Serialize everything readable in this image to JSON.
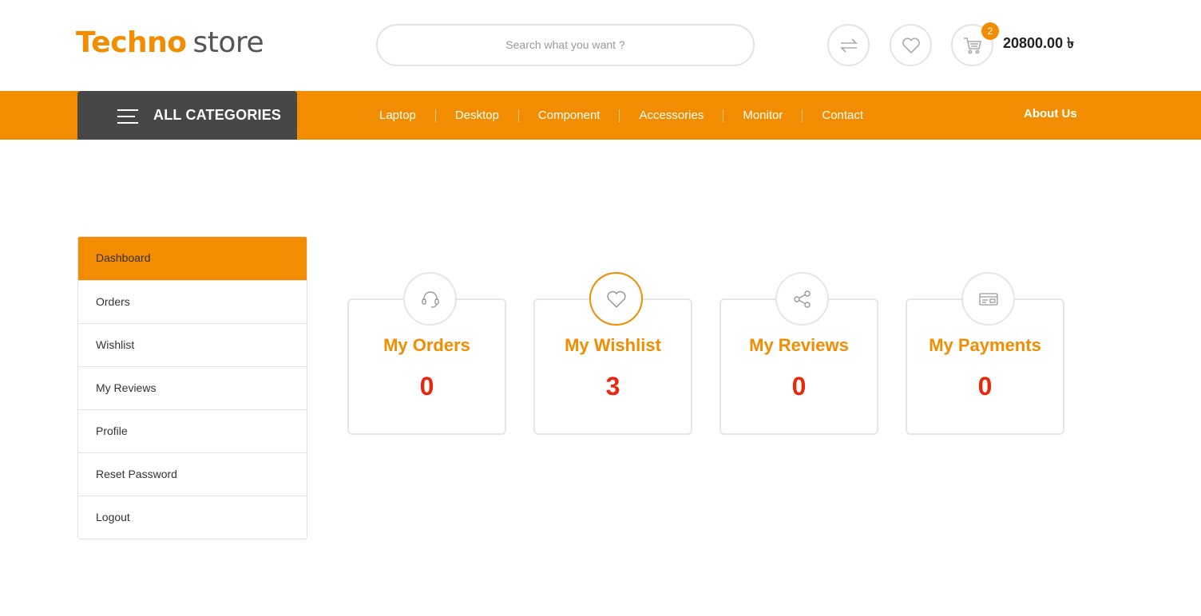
{
  "header": {
    "logo_part1": "Techno",
    "logo_part2": "store",
    "search_placeholder": "Search what you want ?",
    "cart_count": "2",
    "cart_total": "20800.00 ৳",
    "icons": [
      "compare-icon",
      "heart-icon",
      "cart-icon"
    ]
  },
  "nav": {
    "all_categories": "ALL CATEGORIES",
    "links": [
      "Laptop",
      "Desktop",
      "Component",
      "Accessories",
      "Monitor",
      "Contact"
    ],
    "about": "About Us"
  },
  "sidebar": {
    "items": [
      "Dashboard",
      "Orders",
      "Wishlist",
      "My Reviews",
      "Profile",
      "Reset Password",
      "Logout"
    ],
    "active": "Dashboard"
  },
  "cards": [
    {
      "title": "My Orders",
      "count": "0",
      "icon": "headset-icon"
    },
    {
      "title": "My Wishlist",
      "count": "3",
      "icon": "heart-icon"
    },
    {
      "title": "My Reviews",
      "count": "0",
      "icon": "share-icon"
    },
    {
      "title": "My Payments",
      "count": "0",
      "icon": "payment-card-icon"
    }
  ],
  "colors": {
    "accent": "#f28c00",
    "dark": "#474747",
    "count": "#e8270c"
  }
}
